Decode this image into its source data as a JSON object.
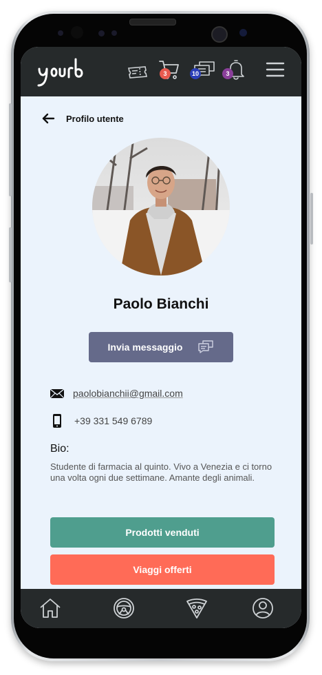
{
  "app": {
    "logo_text": "yourb"
  },
  "topbar": {
    "icons": [
      "ticket-icon",
      "cart-icon",
      "chat-icon",
      "bell-icon",
      "menu-icon"
    ],
    "cart_count": "3",
    "messages_count": "10",
    "notifications_count": "3"
  },
  "header": {
    "title": "Profilo utente"
  },
  "profile": {
    "name": "Paolo Bianchi",
    "message_button": "Invia messaggio",
    "email_user": "paolobianchi",
    "email_domain": "i@gmail.com",
    "phone": "+39 331 549 6789",
    "bio_label": "Bio:",
    "bio": "Studente di farmacia al quinto. Vivo a Venezia e ci torno una volta ogni due settimane. Amante degli animali."
  },
  "actions": {
    "sold_products": "Prodotti venduti",
    "offered_trips": "Viaggi offerti"
  },
  "bottom_nav": {
    "icons": [
      "home-icon",
      "steering-wheel-icon",
      "pizza-icon",
      "user-profile-icon"
    ]
  },
  "colors": {
    "topbar": "#262a2b",
    "screen_bg": "#ebf3fc",
    "message_button": "#656a8a",
    "sold_button": "#4f9e8e",
    "trips_button": "#ff6b57",
    "badge_cart": "#e85a4f",
    "badge_messages": "#2b3fb8",
    "badge_notifications": "#8a3f9a"
  }
}
